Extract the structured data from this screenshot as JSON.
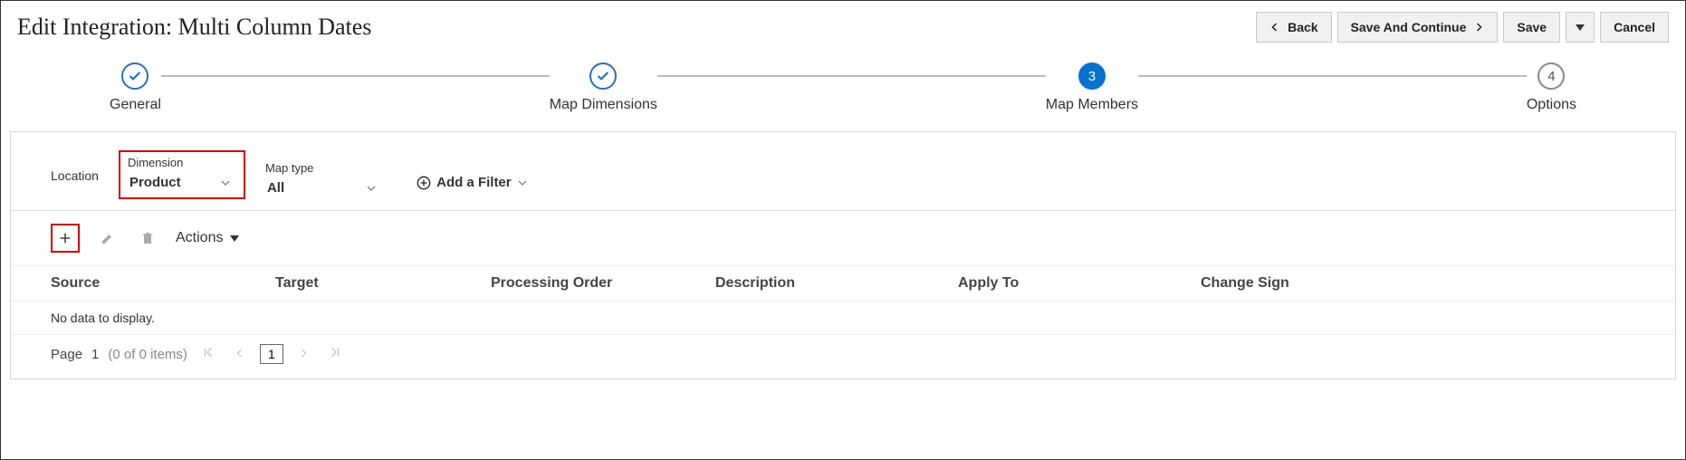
{
  "page_title": "Edit Integration: Multi Column Dates",
  "header_buttons": {
    "back": "Back",
    "save_continue": "Save And Continue",
    "save": "Save",
    "cancel": "Cancel"
  },
  "wizard": {
    "steps": [
      {
        "label": "General",
        "state": "done"
      },
      {
        "label": "Map Dimensions",
        "state": "done"
      },
      {
        "label": "Map Members",
        "state": "active",
        "num": "3"
      },
      {
        "label": "Options",
        "state": "pending",
        "num": "4"
      }
    ]
  },
  "filters": {
    "location_label": "Location",
    "dimension": {
      "label": "Dimension",
      "value": "Product"
    },
    "map_type": {
      "label": "Map type",
      "value": "All"
    },
    "add_filter": "Add a Filter"
  },
  "toolbar": {
    "actions_label": "Actions"
  },
  "table": {
    "columns": [
      "Source",
      "Target",
      "Processing Order",
      "Description",
      "Apply To",
      "Change Sign"
    ],
    "empty": "No data to display."
  },
  "pager": {
    "page_label": "Page",
    "page_number": "1",
    "count_text": "(0 of 0 items)",
    "page_input": "1"
  }
}
